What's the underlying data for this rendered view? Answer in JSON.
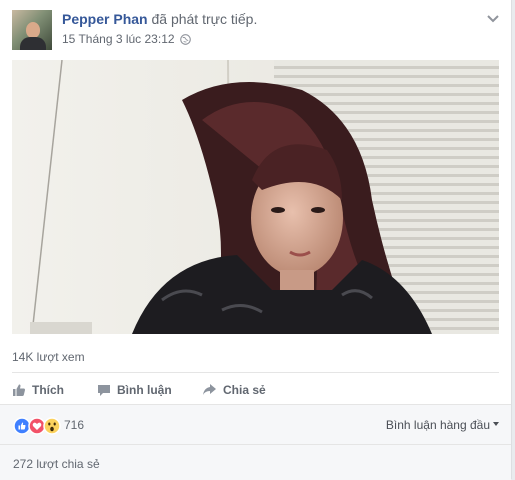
{
  "post": {
    "author_name": "Pepper Phan",
    "action_text": "đã phát trực tiếp.",
    "timestamp": "15 Tháng 3 lúc 23:12",
    "privacy_icon": "globe-icon",
    "menu_icon": "chevron-down-icon"
  },
  "video": {
    "description_icon": "live-video-frame"
  },
  "stats": {
    "views": "14K lượt xem",
    "reaction_count": "716",
    "reactions": [
      "like-icon",
      "love-icon",
      "wow-icon"
    ],
    "shares": "272 lượt chia sẻ"
  },
  "actions": {
    "like_label": "Thích",
    "comment_label": "Bình luận",
    "share_label": "Chia sẻ"
  },
  "comments": {
    "sort_label": "Bình luận hàng đầu"
  },
  "colors": {
    "author_link": "#365899",
    "muted_text": "#616770",
    "like_blue": "#4080ff",
    "love_red": "#f25268",
    "wow_yellow": "#fcd25e"
  }
}
